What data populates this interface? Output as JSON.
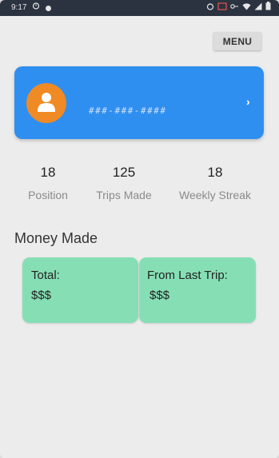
{
  "status_bar": {
    "time": "9:17"
  },
  "header": {
    "menu_label": "MENU"
  },
  "profile": {
    "phone": "###-###-####",
    "chevron": "›"
  },
  "stats": [
    {
      "value": "18",
      "label": "Position"
    },
    {
      "value": "125",
      "label": "Trips Made"
    },
    {
      "value": "18",
      "label": "Weekly Streak"
    }
  ],
  "money": {
    "title": "Money Made",
    "total_label": "Total:",
    "total_value": "$$$",
    "last_trip_label": "From Last Trip:",
    "last_trip_value": "$$$"
  },
  "colors": {
    "profile_card": "#2f8ff0",
    "avatar": "#f08a24",
    "money_card": "#86dfb4",
    "status_bar": "#2b3340"
  },
  "icons": {
    "alarm": "alarm-icon",
    "notification": "notification-dot-icon",
    "wifi": "wifi-icon",
    "signal": "signal-icon",
    "battery": "battery-icon",
    "avatar": "person-icon",
    "chevron": "chevron-right-icon"
  }
}
